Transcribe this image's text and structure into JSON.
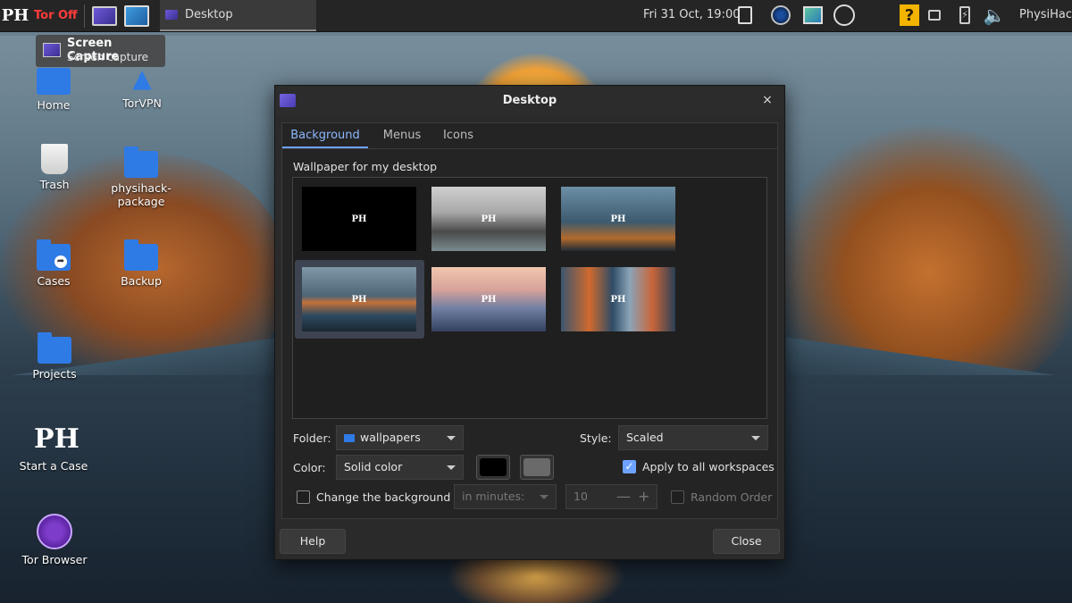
{
  "panel": {
    "logo_text": "PH",
    "tor_status": "Tor Off",
    "task_button_label": "Desktop",
    "clock": "Fri 31 Oct, 19:00",
    "username": "PhysiHack",
    "tray_icons": [
      "clipboard-icon",
      "network-icon",
      "system-monitor-icon",
      "speedometer-icon",
      "help-icon",
      "window-icon",
      "battery-icon",
      "volume-icon"
    ]
  },
  "tooltip": {
    "title": "Screen Capture",
    "subtitle": "Screen capture"
  },
  "desktop_icons": [
    {
      "label": "Home"
    },
    {
      "label": "TorVPN"
    },
    {
      "label": "Trash"
    },
    {
      "label": "physihack-package"
    },
    {
      "label": "Cases"
    },
    {
      "label": "Backup"
    },
    {
      "label": "Projects"
    },
    {
      "label": "Start a Case"
    },
    {
      "label": "Tor Browser"
    }
  ],
  "dialog": {
    "title": "Desktop",
    "close_glyph": "×",
    "tabs": [
      {
        "label": "Background",
        "active": true
      },
      {
        "label": "Menus",
        "active": false
      },
      {
        "label": "Icons",
        "active": false
      }
    ],
    "wallpaper_label": "Wallpaper for my desktop",
    "thumbnail_logo": "PH",
    "folder_label": "Folder:",
    "folder_value": "wallpapers",
    "style_label": "Style:",
    "style_value": "Scaled",
    "color_label": "Color:",
    "color_value": "Solid color",
    "color_primary": "#000000",
    "color_secondary": "#6a6a6a",
    "apply_all_label": "Apply to all workspaces",
    "apply_all_checked": true,
    "change_bg_label": "Change the background",
    "change_bg_checked": false,
    "interval_placeholder": "in minutes:",
    "interval_value": "10",
    "random_order_label": "Random Order",
    "help_button": "Help",
    "close_button": "Close"
  }
}
